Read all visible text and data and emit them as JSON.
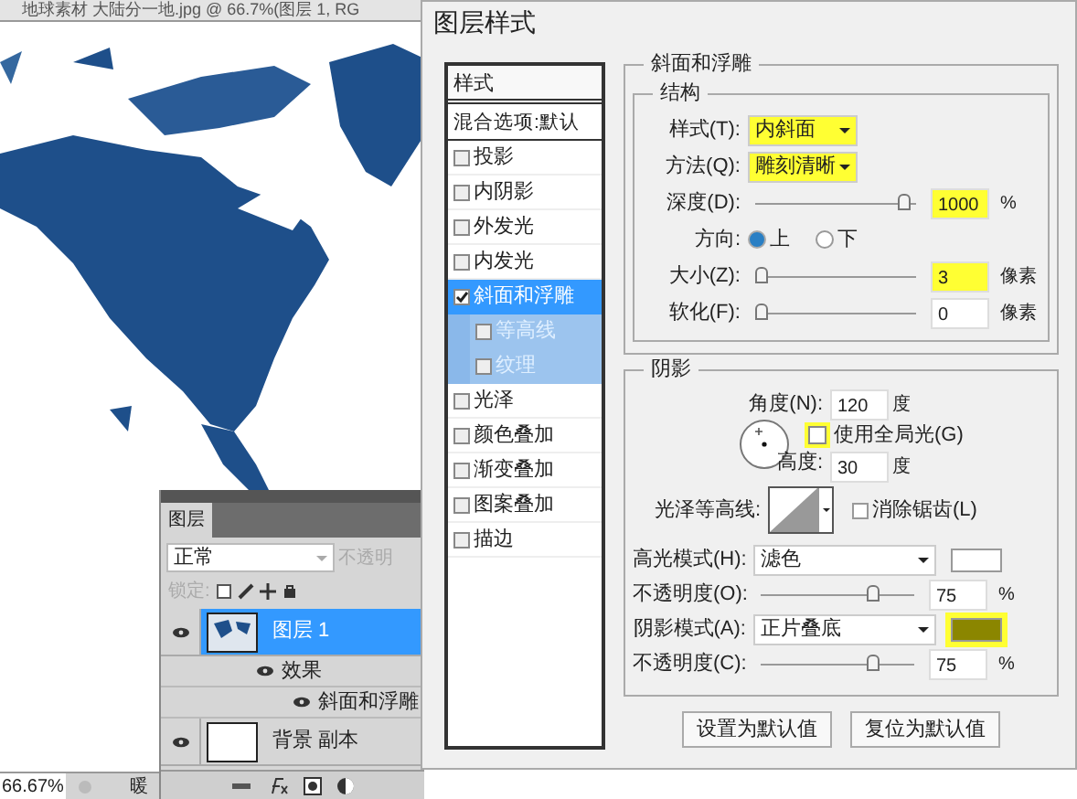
{
  "document": {
    "title": "地球素材 大陆分一地.jpg @ 66.7%(图层 1, RG",
    "zoom": "66.67%",
    "status_text": "暖"
  },
  "layers_panel": {
    "tab": "图层",
    "blend_mode": "正常",
    "opacity_label": "不透明",
    "lock_label": "锁定:",
    "layers": [
      {
        "name": "图层 1",
        "selected": true,
        "children": [
          {
            "name": "效果",
            "children": [
              {
                "name": "斜面和浮雕"
              }
            ]
          }
        ]
      },
      {
        "name": "背景 副本",
        "selected": false,
        "kind": "blank"
      }
    ]
  },
  "dialog": {
    "title": "图层样式",
    "styles_header": "样式",
    "blending_options": "混合选项:默认",
    "styles": [
      {
        "label": "投影",
        "checked": false,
        "selected": false
      },
      {
        "label": "内阴影",
        "checked": false,
        "selected": false
      },
      {
        "label": "外发光",
        "checked": false,
        "selected": false
      },
      {
        "label": "内发光",
        "checked": false,
        "selected": false
      },
      {
        "label": "斜面和浮雕",
        "checked": true,
        "selected": true,
        "children": [
          {
            "label": "等高线",
            "checked": false,
            "selected": false
          },
          {
            "label": "纹理",
            "checked": false,
            "selected": false
          }
        ]
      },
      {
        "label": "光泽",
        "checked": false,
        "selected": false
      },
      {
        "label": "颜色叠加",
        "checked": false,
        "selected": false
      },
      {
        "label": "渐变叠加",
        "checked": false,
        "selected": false
      },
      {
        "label": "图案叠加",
        "checked": false,
        "selected": false
      },
      {
        "label": "描边",
        "checked": false,
        "selected": false
      }
    ],
    "section_title": "斜面和浮雕",
    "structure": {
      "title": "结构",
      "style": {
        "label": "样式(T):",
        "value": "内斜面",
        "highlighted": true
      },
      "technique": {
        "label": "方法(Q):",
        "value": "雕刻清晰",
        "highlighted": true
      },
      "depth": {
        "label": "深度(D):",
        "level": 0.96,
        "value": "1000",
        "unit": "%",
        "highlighted": true
      },
      "direction": {
        "label": "方向:",
        "options": [
          {
            "label": "上",
            "selected": true
          },
          {
            "label": "下",
            "selected": false
          }
        ]
      },
      "size": {
        "label": "大小(Z):",
        "level": 0,
        "value": "3",
        "unit": "像素",
        "highlighted": true
      },
      "soften": {
        "label": "软化(F):",
        "level": 0,
        "value": "0",
        "unit": "像素",
        "highlighted": false
      }
    },
    "shading": {
      "title": "阴影",
      "angle": {
        "label": "角度(N):",
        "value": "120",
        "unit": "度"
      },
      "global_light": {
        "label": "使用全局光(G)",
        "checked": false,
        "highlighted": true
      },
      "altitude": {
        "label": "高度:",
        "value": "30",
        "unit": "度"
      },
      "gloss_contour": {
        "label": "光泽等高线:"
      },
      "anti_aliased": {
        "label": "消除锯齿(L)",
        "checked": false
      },
      "highlight_mode": {
        "label": "高光模式(H):",
        "value": "滤色",
        "color": "#ffffff",
        "highlighted": false
      },
      "highlight_opacity": {
        "label": "不透明度(O):",
        "level": 0.75,
        "value": "75",
        "unit": "%"
      },
      "shadow_mode": {
        "label": "阴影模式(A):",
        "value": "正片叠底",
        "color": "#8b8600",
        "highlighted": true
      },
      "shadow_opacity": {
        "label": "不透明度(C):",
        "level": 0.75,
        "value": "75",
        "unit": "%"
      }
    },
    "buttons": [
      "设置为默认值",
      "复位为默认值"
    ]
  }
}
